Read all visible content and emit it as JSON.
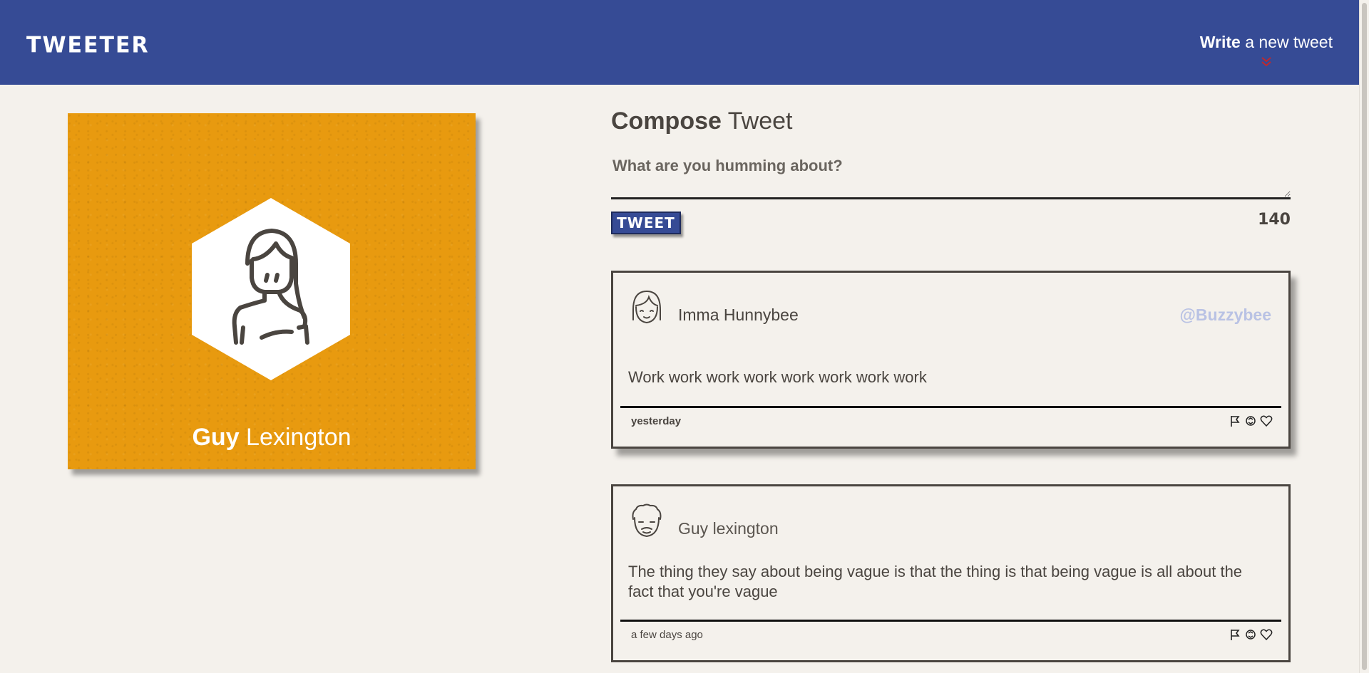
{
  "header": {
    "logo": "TWEETER",
    "compose_link": {
      "bold": "Write",
      "rest": " a new tweet"
    },
    "colors": {
      "bar": "#364b95",
      "chevron": "#c0282d"
    }
  },
  "profile": {
    "first_name": "Guy",
    "last_name": " Lexington",
    "avatar_icon": "girl-avatar-icon",
    "card_color": "#e89a0f"
  },
  "compose": {
    "title_bold": "Compose",
    "title_rest": " Tweet",
    "placeholder": "What are you humming about?",
    "button_label": "TWEET",
    "counter": "140"
  },
  "tweets": [
    {
      "name": "Imma Hunnybee",
      "handle": "@Buzzybee",
      "content": "Work work work work work work work work",
      "time": "yesterday",
      "avatar_icon": "woman-avatar-icon",
      "actions": [
        "flag-icon",
        "retweet-icon",
        "heart-icon"
      ]
    },
    {
      "name": "Guy lexington",
      "handle": "",
      "content": "The thing they say about being vague is that the thing is that being vague is all about the fact that you're vague",
      "time": "a few days ago",
      "avatar_icon": "man-avatar-icon",
      "actions": [
        "flag-icon",
        "retweet-icon",
        "heart-icon"
      ]
    }
  ]
}
